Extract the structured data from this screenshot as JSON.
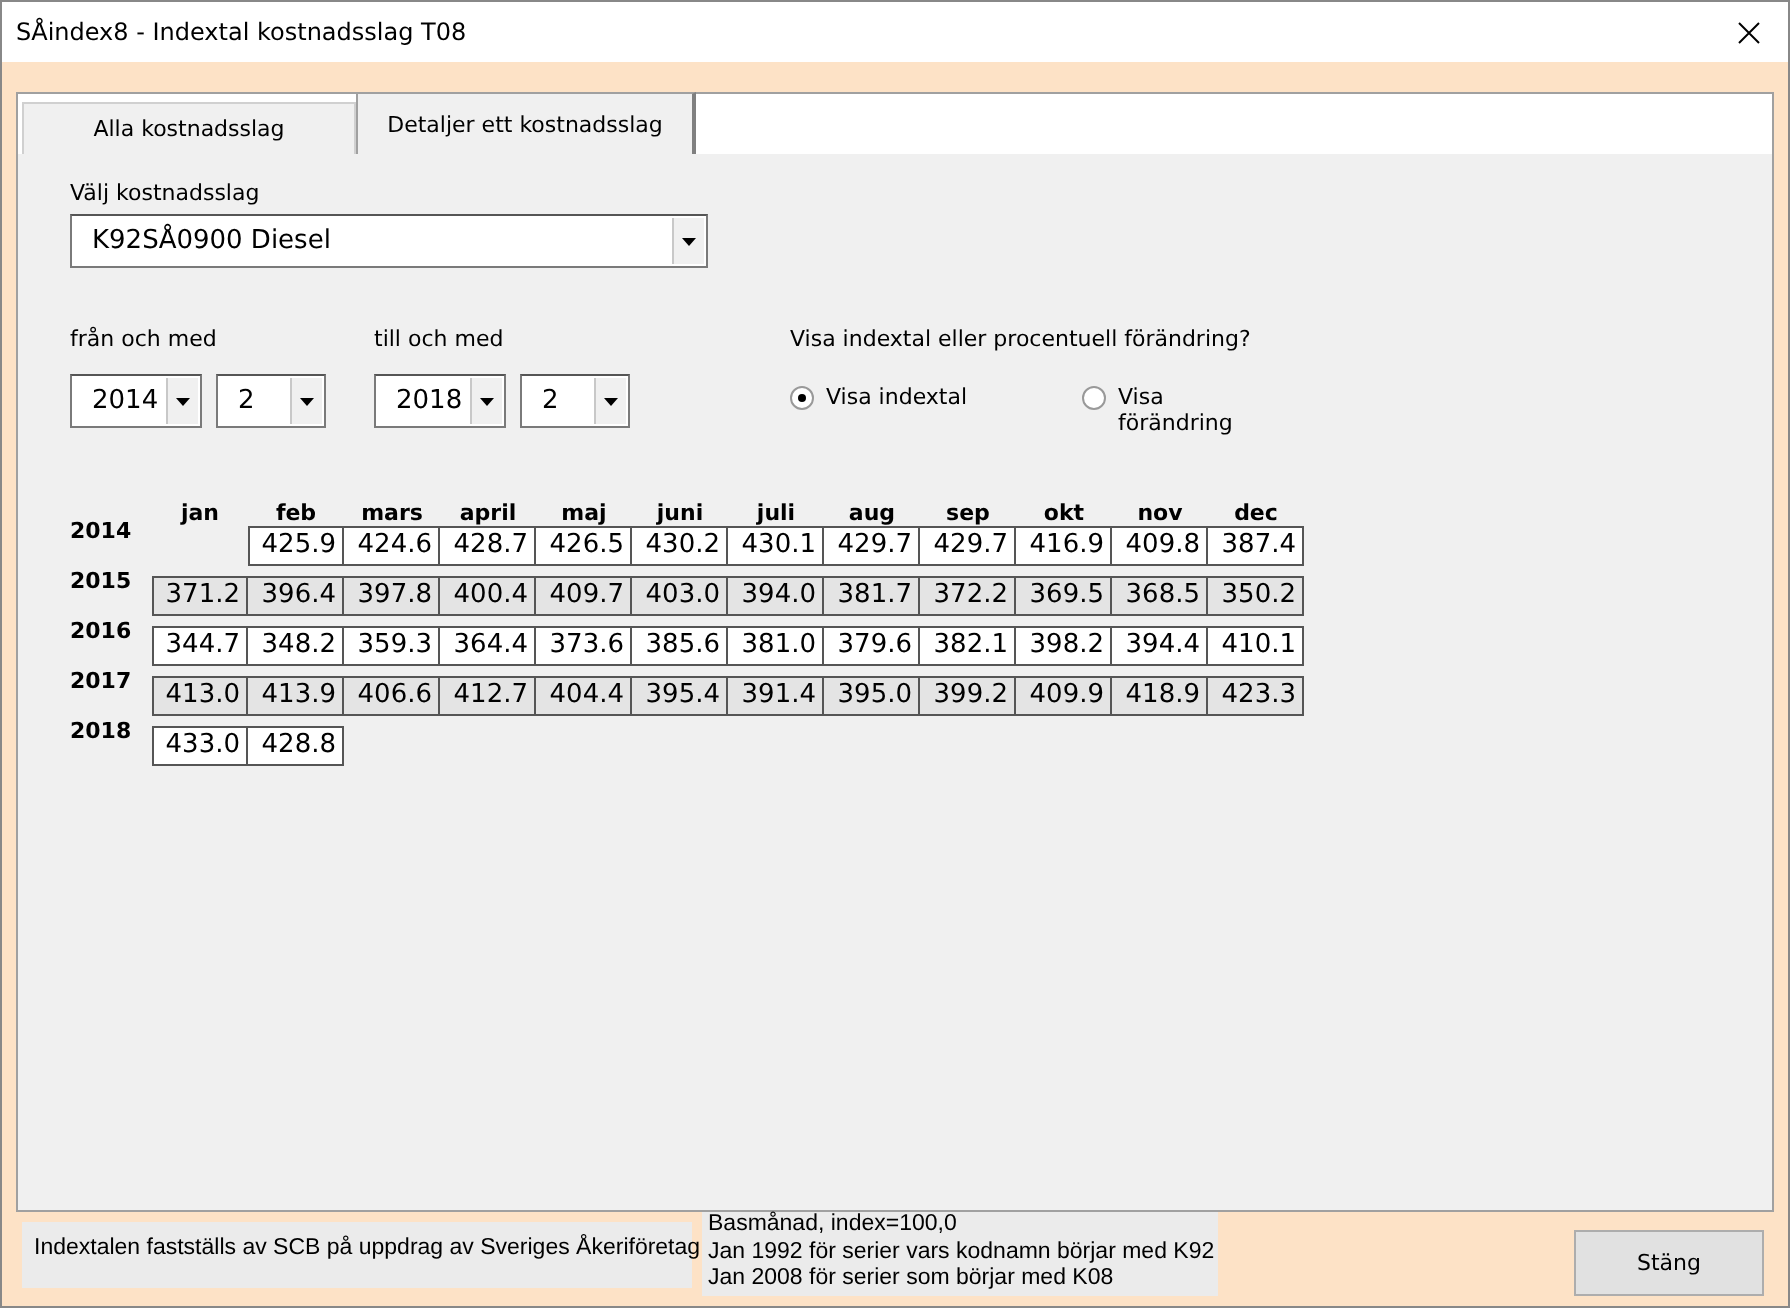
{
  "window": {
    "title": "SÅindex8 - Indextal kostnadsslag T08"
  },
  "tabs": [
    {
      "label": "Alla kostnadsslag",
      "selected": false
    },
    {
      "label": "Detaljer ett kostnadsslag",
      "selected": true
    }
  ],
  "cost_type": {
    "label": "Välj kostnadsslag",
    "value": "K92SÅ0900 Diesel"
  },
  "from": {
    "label": "från och med",
    "year": "2014",
    "month": "2"
  },
  "to": {
    "label": "till och med",
    "year": "2018",
    "month": "2"
  },
  "display_mode": {
    "question": "Visa indextal eller procentuell förändring?",
    "options": [
      {
        "label": "Visa indextal",
        "selected": true
      },
      {
        "label": "Visa förändring",
        "selected": false
      }
    ]
  },
  "table": {
    "columns": [
      "jan",
      "feb",
      "mars",
      "april",
      "maj",
      "juni",
      "juli",
      "aug",
      "sep",
      "okt",
      "nov",
      "dec"
    ],
    "rows": [
      {
        "year": "2014",
        "shaded": false,
        "cells": [
          null,
          "425.9",
          "424.6",
          "428.7",
          "426.5",
          "430.2",
          "430.1",
          "429.7",
          "429.7",
          "416.9",
          "409.8",
          "387.4"
        ]
      },
      {
        "year": "2015",
        "shaded": true,
        "cells": [
          "371.2",
          "396.4",
          "397.8",
          "400.4",
          "409.7",
          "403.0",
          "394.0",
          "381.7",
          "372.2",
          "369.5",
          "368.5",
          "350.2"
        ]
      },
      {
        "year": "2016",
        "shaded": false,
        "cells": [
          "344.7",
          "348.2",
          "359.3",
          "364.4",
          "373.6",
          "385.6",
          "381.0",
          "379.6",
          "382.1",
          "398.2",
          "394.4",
          "410.1"
        ]
      },
      {
        "year": "2017",
        "shaded": true,
        "cells": [
          "413.0",
          "413.9",
          "406.6",
          "412.7",
          "404.4",
          "395.4",
          "391.4",
          "395.0",
          "399.2",
          "409.9",
          "418.9",
          "423.3"
        ]
      },
      {
        "year": "2018",
        "shaded": false,
        "cells": [
          "433.0",
          "428.8"
        ]
      }
    ]
  },
  "footer": {
    "note": "Indextalen fastställs av SCB på uppdrag av Sveriges Åkeriföretag",
    "base_info": [
      "Basmånad, index=100,0",
      "Jan 1992 för serier vars kodnamn börjar med K92",
      "Jan 2008 för serier som börjar med K08"
    ],
    "close_button": "Stäng"
  }
}
